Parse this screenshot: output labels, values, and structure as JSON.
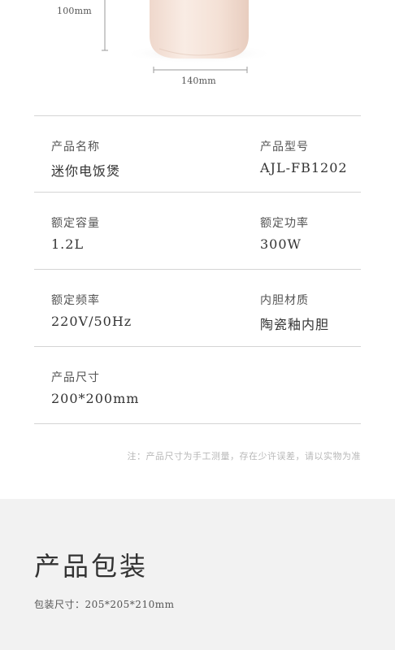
{
  "dimensions": {
    "height_label": "100mm",
    "width_label": "140mm"
  },
  "specs": [
    {
      "left": {
        "label": "产品名称",
        "value": "迷你电饭煲"
      },
      "right": {
        "label": "产品型号",
        "value": "AJL-FB1202"
      }
    },
    {
      "left": {
        "label": "额定容量",
        "value": "1.2L"
      },
      "right": {
        "label": "额定功率",
        "value": "300W"
      }
    },
    {
      "left": {
        "label": "额定频率",
        "value": "220V/50Hz"
      },
      "right": {
        "label": "内胆材质",
        "value": "陶瓷釉内胆"
      }
    },
    {
      "left": {
        "label": "产品尺寸",
        "value": "200*200mm"
      }
    }
  ],
  "note": "注：产品尺寸为手工测量，存在少许误差，请以实物为准",
  "packaging": {
    "title": "产品包装",
    "size_text": "包装尺寸：205*205*210mm"
  }
}
